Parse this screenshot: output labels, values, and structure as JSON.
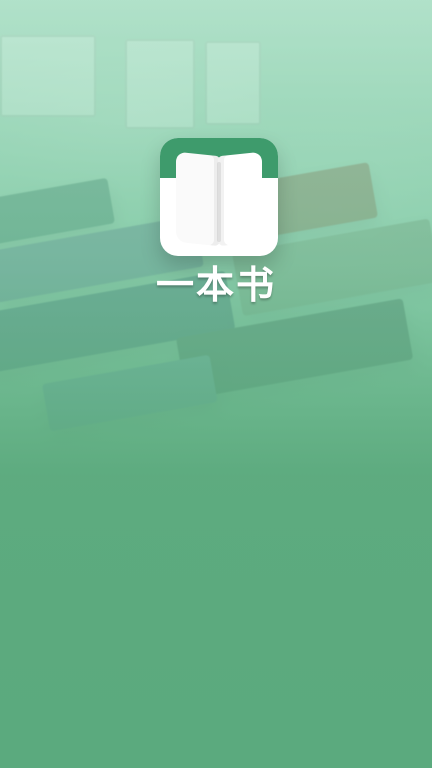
{
  "app": {
    "name": "一本书"
  },
  "colors": {
    "theme_green": "#5BAA7E",
    "icon_green": "#3E9B6C"
  },
  "icons": {
    "app_icon": "book-icon"
  }
}
